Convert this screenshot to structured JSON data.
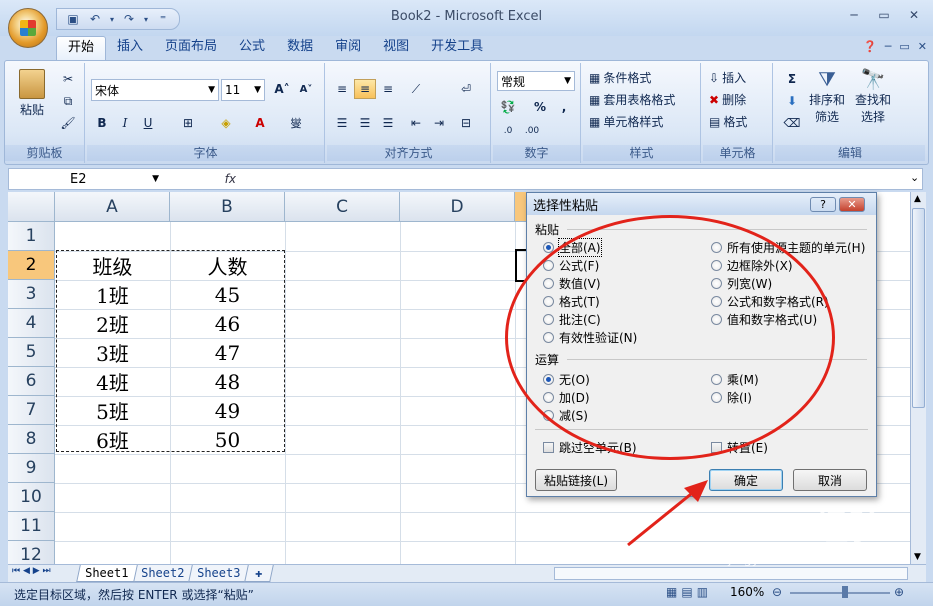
{
  "app": {
    "title": "Book2 - Microsoft Excel"
  },
  "tabs": [
    "开始",
    "插入",
    "页面布局",
    "公式",
    "数据",
    "审阅",
    "视图",
    "开发工具"
  ],
  "ribbon": {
    "clipboard": {
      "paste": "粘贴",
      "label": "剪贴板"
    },
    "font": {
      "name": "宋体",
      "size": "11",
      "label": "字体"
    },
    "alignment": {
      "label": "对齐方式"
    },
    "number": {
      "format": "常规",
      "label": "数字"
    },
    "styles": {
      "conditional": "条件格式",
      "table": "套用表格格式",
      "cell": "单元格样式",
      "label": "样式"
    },
    "cells": {
      "insert": "插入",
      "delete": "删除",
      "format": "格式",
      "label": "单元格"
    },
    "editing": {
      "sort1": "排序和",
      "sort2": "筛选",
      "find1": "查找和",
      "find2": "选择",
      "label": "编辑"
    }
  },
  "formula_bar": {
    "name_box": "E2",
    "fx": "fx"
  },
  "columns": [
    "A",
    "B",
    "C",
    "D"
  ],
  "rows": [
    "1",
    "2",
    "3",
    "4",
    "5",
    "6",
    "7",
    "8",
    "9",
    "10",
    "11",
    "12"
  ],
  "table": {
    "headers": [
      "班级",
      "人数"
    ],
    "rows": [
      [
        "1班",
        "45"
      ],
      [
        "2班",
        "46"
      ],
      [
        "3班",
        "47"
      ],
      [
        "4班",
        "48"
      ],
      [
        "5班",
        "49"
      ],
      [
        "6班",
        "50"
      ]
    ]
  },
  "sheets": [
    "Sheet1",
    "Sheet2",
    "Sheet3"
  ],
  "status": {
    "text": "选定目标区域，然后按 ENTER 或选择“粘贴”",
    "zoom": "160%"
  },
  "dialog": {
    "title": "选择性粘贴",
    "help": "?",
    "paste_section": "粘贴",
    "paste_left": [
      "全部(A)",
      "公式(F)",
      "数值(V)",
      "格式(T)",
      "批注(C)",
      "有效性验证(N)"
    ],
    "paste_right": [
      "所有使用源主题的单元(H)",
      "边框除外(X)",
      "列宽(W)",
      "公式和数字格式(R)",
      "值和数字格式(U)"
    ],
    "op_section": "运算",
    "op_left": [
      "无(O)",
      "加(D)",
      "减(S)"
    ],
    "op_right": [
      "乘(M)",
      "除(I)"
    ],
    "skip_blanks": "跳过空单元(B)",
    "transpose": "转置(E)",
    "paste_link": "粘贴链接(L)",
    "ok": "确定",
    "cancel": "取消"
  },
  "watermark": {
    "logo": "Baidu经验",
    "url": "jingyan.baidu.com"
  },
  "colors": {
    "accent": "#f8c77c",
    "annotation": "#e2231a"
  }
}
